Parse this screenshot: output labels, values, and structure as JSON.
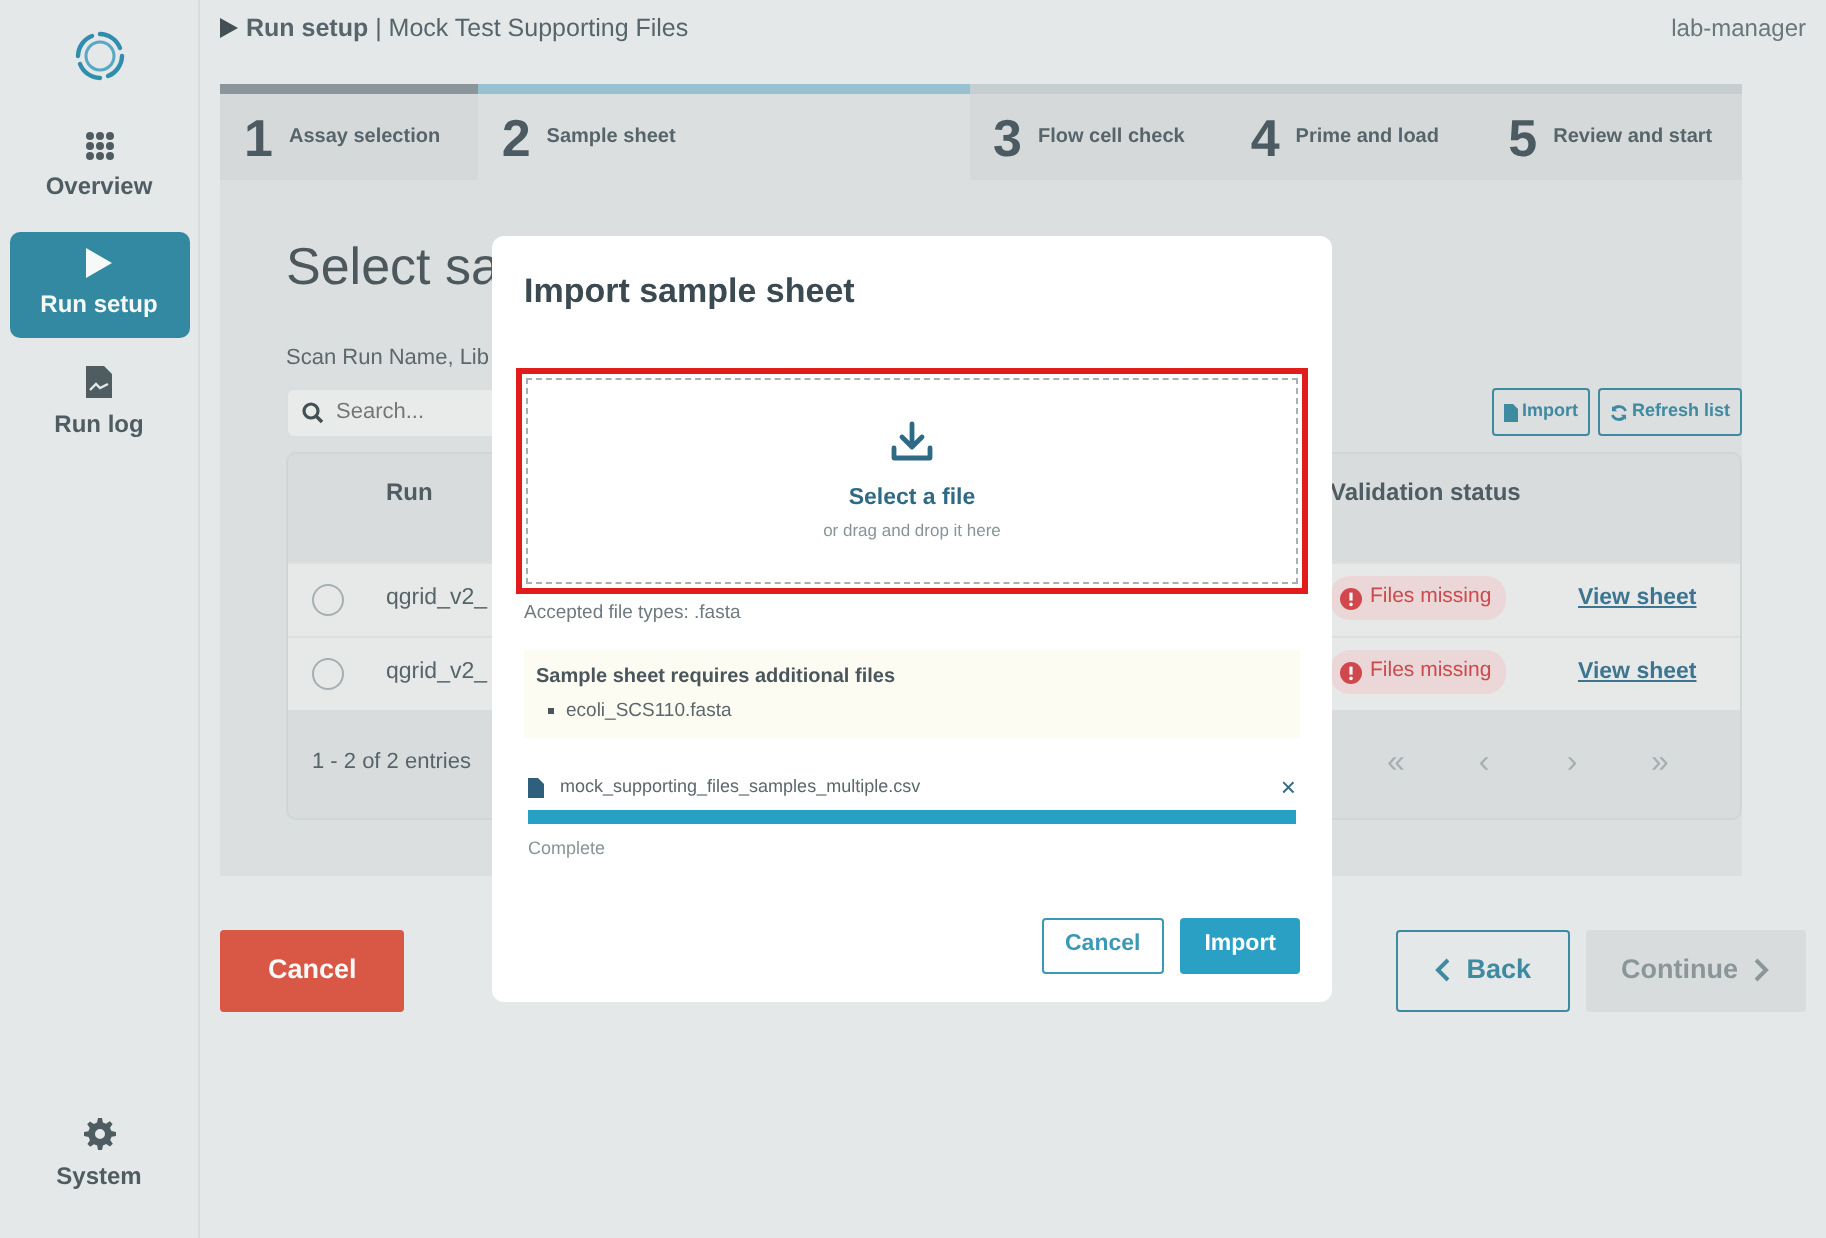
{
  "header": {
    "breadcrumb": "**Run setup** | Mock Test Supporting Files",
    "user": "lab-manager"
  },
  "sidebar": {
    "items": [
      {
        "label": "Overview",
        "selected": false
      },
      {
        "label": "Run setup",
        "selected": true
      },
      {
        "label": "Run log",
        "selected": false
      }
    ],
    "footer_item": {
      "label": "System",
      "selected": false
    }
  },
  "steps": [
    {
      "number": "1",
      "label": "Assay selection",
      "completed": true,
      "selected": false
    },
    {
      "number": "2",
      "label": "Sample sheet",
      "completed": false,
      "selected": true
    },
    {
      "number": "3",
      "label": "Flow cell check",
      "completed": false,
      "selected": false
    },
    {
      "number": "4",
      "label": "Prime and load",
      "completed": false,
      "selected": false
    },
    {
      "number": "5",
      "label": "Review and start",
      "completed": false,
      "selected": false
    }
  ],
  "page": {
    "heading": "Select sa",
    "hint": "Scan Run Name, Lib",
    "search": {
      "placeholder": "Search..."
    },
    "buttons": [
      {
        "label": "Import"
      },
      {
        "label": "Refresh list"
      }
    ]
  },
  "table": {
    "columns": [
      "Run",
      "Validation status"
    ],
    "rows": [
      {
        "selected": false,
        "run": "qgrid_v2_",
        "status": "Files missing",
        "action": "View sheet"
      },
      {
        "selected": false,
        "run": "qgrid_v2_",
        "status": "Files missing",
        "action": "View sheet"
      }
    ],
    "footer": "1 - 2 of 2 entries",
    "pager": [
      "«",
      "‹",
      "›",
      "»"
    ]
  },
  "actions": [
    {
      "label": "Cancel",
      "kind": "danger",
      "disabled": false
    },
    {
      "label": "Back",
      "kind": "back",
      "disabled": false
    },
    {
      "label": "Continue",
      "kind": "next",
      "disabled": true
    }
  ],
  "modal": {
    "title": "Import sample sheet",
    "dropzone": {
      "title": "Select a file",
      "subtitle": "or drag and drop it here",
      "highlighted": true
    },
    "accepted": "Accepted file types: .fasta",
    "notice": {
      "title": "Sample sheet requires additional files",
      "items": [
        "ecoli_SCS110.fasta"
      ]
    },
    "upload": {
      "file": "mock_supporting_files_samples_multiple.csv",
      "remove": "×",
      "level": 1,
      "status": "Complete"
    },
    "buttons": [
      {
        "label": "Cancel",
        "kind": "secondary"
      },
      {
        "label": "Import",
        "kind": "primary"
      }
    ]
  }
}
